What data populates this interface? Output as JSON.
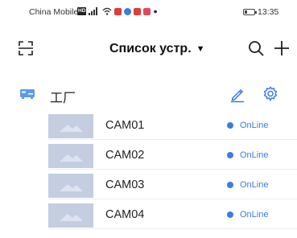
{
  "status_bar": {
    "carrier": "China Mobile",
    "time": "13:35",
    "battery_level": 0.3,
    "icons": [
      "hd-icon",
      "signal-icon",
      "wifi-icon",
      "notification-icons"
    ]
  },
  "header": {
    "title": "Список устр.",
    "title_dropdown_icon": "caret-down-icon",
    "left_icon": "scan-icon",
    "right_icons": [
      "search-icon",
      "add-icon"
    ]
  },
  "group": {
    "name": "工厂",
    "icon": "dvr-icon",
    "actions": [
      "edit-icon",
      "settings-icon"
    ]
  },
  "cameras": [
    {
      "name": "CAM01",
      "status": "OnLine"
    },
    {
      "name": "CAM02",
      "status": "OnLine"
    },
    {
      "name": "CAM03",
      "status": "OnLine"
    },
    {
      "name": "CAM04",
      "status": "OnLine"
    }
  ],
  "colors": {
    "accent": "#3a7be8",
    "thumbnail": "#c4cee0",
    "icon_stroke": "#1f1f1f"
  }
}
